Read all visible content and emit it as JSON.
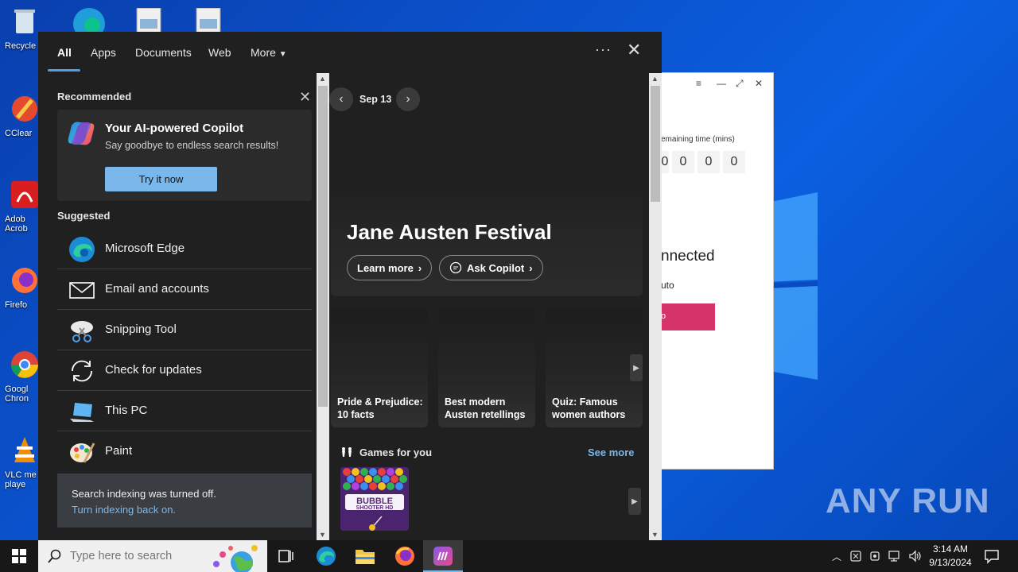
{
  "desktop": {
    "icons": [
      {
        "label": "Recycle",
        "name": "recycle-bin-icon"
      },
      {
        "label": "CClear",
        "name": "ccleaner-icon"
      },
      {
        "label": "Adob Acrob",
        "name": "adobe-acrobat-icon"
      },
      {
        "label": "Firefo",
        "name": "firefox-icon"
      },
      {
        "label": "Googl Chron",
        "name": "chrome-icon"
      },
      {
        "label": "VLC me playe",
        "name": "vlc-icon"
      }
    ],
    "watermark": "ANY RUN"
  },
  "bg_window": {
    "remaining_label": "emaining time (mins)",
    "digits": [
      "0",
      "0",
      "0",
      "0"
    ],
    "status": "nnected",
    "auto": "uto",
    "button": "o"
  },
  "search_panel": {
    "tabs": [
      "All",
      "Apps",
      "Documents",
      "Web",
      "More"
    ],
    "recommended_heading": "Recommended",
    "copilot": {
      "title": "Your AI-powered Copilot",
      "subtitle": "Say goodbye to endless search results!",
      "button": "Try it now"
    },
    "suggested_heading": "Suggested",
    "suggested": [
      {
        "label": "Microsoft Edge",
        "icon": "edge-icon"
      },
      {
        "label": "Email and accounts",
        "icon": "mail-icon"
      },
      {
        "label": "Snipping Tool",
        "icon": "snipping-tool-icon"
      },
      {
        "label": "Check for updates",
        "icon": "sync-icon"
      },
      {
        "label": "This PC",
        "icon": "computer-icon"
      },
      {
        "label": "Paint",
        "icon": "paint-icon"
      }
    ],
    "indexing": {
      "message": "Search indexing was turned off.",
      "link": "Turn indexing back on."
    },
    "date": "Sep 13",
    "hero": {
      "title": "Jane Austen Festival",
      "learn_more": "Learn more",
      "ask_copilot": "Ask Copilot"
    },
    "cards": [
      {
        "title": "Pride & Prejudice: 10 facts"
      },
      {
        "title": "Best modern Austen retellings"
      },
      {
        "title": "Quiz: Famous women authors"
      }
    ],
    "games": {
      "heading": "Games for you",
      "see_more": "See more",
      "tile_text": "BUBBLE SHOOTER HD"
    }
  },
  "taskbar": {
    "search_placeholder": "Type here to search",
    "time": "3:14 AM",
    "date": "9/13/2024"
  },
  "colors": {
    "accent": "#7ab8ec",
    "panel_bg": "#202020",
    "taskbar_bg": "#181818"
  }
}
